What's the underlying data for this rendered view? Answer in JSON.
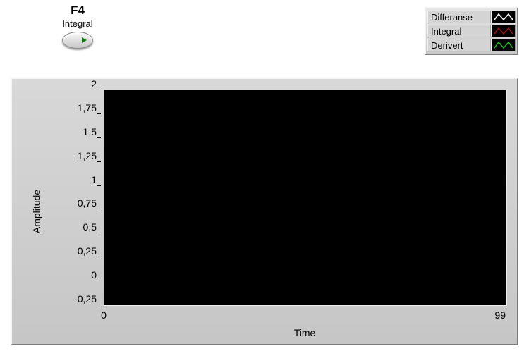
{
  "control": {
    "title": "F4",
    "subtitle": "Integral"
  },
  "legend": {
    "items": [
      {
        "label": "Differanse",
        "color": "#ffffff"
      },
      {
        "label": "Integral",
        "color": "#a01818"
      },
      {
        "label": "Derivert",
        "color": "#18c018"
      }
    ]
  },
  "chart_data": {
    "type": "line",
    "title": "",
    "xlabel": "Time",
    "ylabel": "Amplitude",
    "xlim": [
      0,
      99
    ],
    "ylim": [
      -0.25,
      2
    ],
    "x_ticks": [
      0,
      99
    ],
    "y_ticks": [
      -0.25,
      0,
      0.25,
      0.5,
      0.75,
      1,
      1.25,
      1.5,
      1.75,
      2
    ],
    "y_tick_labels": [
      "-0,25",
      "0",
      "0,25",
      "0,5",
      "0,75",
      "1",
      "1,25",
      "1,5",
      "1,75",
      "2"
    ],
    "series": [
      {
        "name": "Differanse",
        "color": "#ffffff",
        "values": []
      },
      {
        "name": "Integral",
        "color": "#a01818",
        "values": []
      },
      {
        "name": "Derivert",
        "color": "#18c018",
        "values": []
      }
    ]
  }
}
